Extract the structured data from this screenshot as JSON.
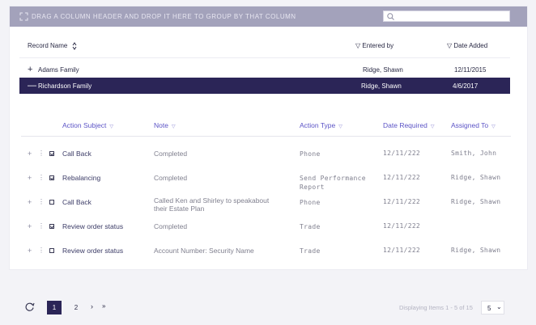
{
  "group_bar": {
    "text": "DRAG A COLUMN HEADER AND DROP IT HERE TO GROUP BY THAT COLUMN",
    "search_value": "",
    "icon": "expand-icon"
  },
  "records": {
    "headers": {
      "name": "Record Name",
      "entered_by": "Entered by",
      "date_added": "Date Added"
    },
    "rows": [
      {
        "expander": "+",
        "name": "Adams Family",
        "entered_by": "Ridge, Shawn",
        "date_added": "12/11/2015"
      },
      {
        "expander": "—",
        "name": "Richardson Family",
        "entered_by": "Ridge, Shawn",
        "date_added": "4/6/2017"
      }
    ]
  },
  "actions": {
    "headers": {
      "subject": "Action Subject",
      "note": "Note",
      "type": "Action Type",
      "date_required": "Date Required",
      "assigned_to": "Assigned To"
    },
    "rows": [
      {
        "checked": true,
        "subject": "Call Back",
        "note": "Completed",
        "type": "Phone",
        "date_required": "12/11/222",
        "assigned_to": "Smith, John"
      },
      {
        "checked": true,
        "subject": "Rebalancing",
        "note": "Completed",
        "type": "Send Performance\nReport",
        "date_required": "12/11/222",
        "assigned_to": "Ridge, Shawn"
      },
      {
        "checked": false,
        "subject": "Call Back",
        "note": "Called Ken and Shirley to speakabout\ntheir Estate Plan",
        "type": "Phone",
        "date_required": "12/11/222",
        "assigned_to": "Ridge, Shawn"
      },
      {
        "checked": true,
        "subject": "Review order status",
        "note": "Completed",
        "type": "Trade",
        "date_required": "12/11/222",
        "assigned_to": ""
      },
      {
        "checked": false,
        "subject": "Review order status",
        "note": "Account Number: Security Name",
        "type": "Trade",
        "date_required": "12/11/222",
        "assigned_to": "Ridge, Shawn"
      }
    ]
  },
  "pager": {
    "pages": [
      "1",
      "2"
    ],
    "current": "1",
    "next": "›",
    "last": "»",
    "display": "Displaying Items 1 - 5 of 15",
    "page_size": "5",
    "page_size_chevron": "⌄"
  },
  "colors": {
    "accent": "#2b2557",
    "group_bar": "#a3a2bb",
    "link": "#5b53c6"
  }
}
